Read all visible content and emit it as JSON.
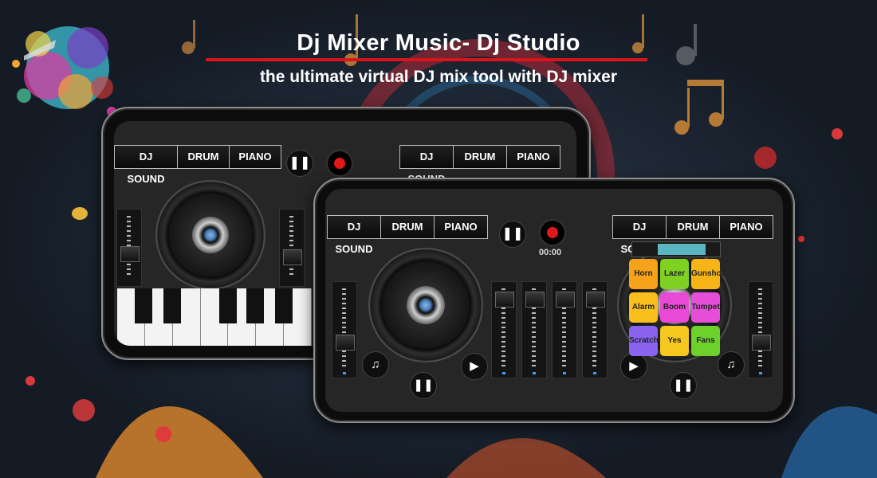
{
  "banner": {
    "title": "Dj Mixer Music- Dj Studio",
    "subtitle": "the ultimate virtual DJ mix tool with DJ  mixer"
  },
  "back_phone": {
    "left_tabs": [
      "DJ SOUND",
      "DRUM",
      "PIANO"
    ],
    "right_tabs": [
      "DJ SOUND",
      "DRUM",
      "PIANO"
    ]
  },
  "front_phone": {
    "left_tabs": [
      "DJ SOUND",
      "DRUM",
      "PIANO"
    ],
    "right_tabs": [
      "DJ SOUND",
      "DRUM",
      "PIANO"
    ],
    "timer": "00:00",
    "pads": [
      {
        "label": "Horn",
        "color": "#f6a21b"
      },
      {
        "label": "Lazer",
        "color": "#7ed021"
      },
      {
        "label": "Gunshot",
        "color": "#f7b417"
      },
      {
        "label": "Alarm",
        "color": "#f8bf1d"
      },
      {
        "label": "Boom",
        "color": "#e94ad5"
      },
      {
        "label": "Tumpet",
        "color": "#e54fd8"
      },
      {
        "label": "Scratch",
        "color": "#8a63ef"
      },
      {
        "label": "Yes",
        "color": "#f6c81f"
      },
      {
        "label": "Fans",
        "color": "#6ed12b"
      }
    ]
  },
  "icons": {
    "pause": "pause-icon",
    "play": "play-icon",
    "record": "record-icon",
    "playlist": "music-list-icon"
  },
  "colors": {
    "accent_red": "#d9141b",
    "background": "#1b2532"
  }
}
